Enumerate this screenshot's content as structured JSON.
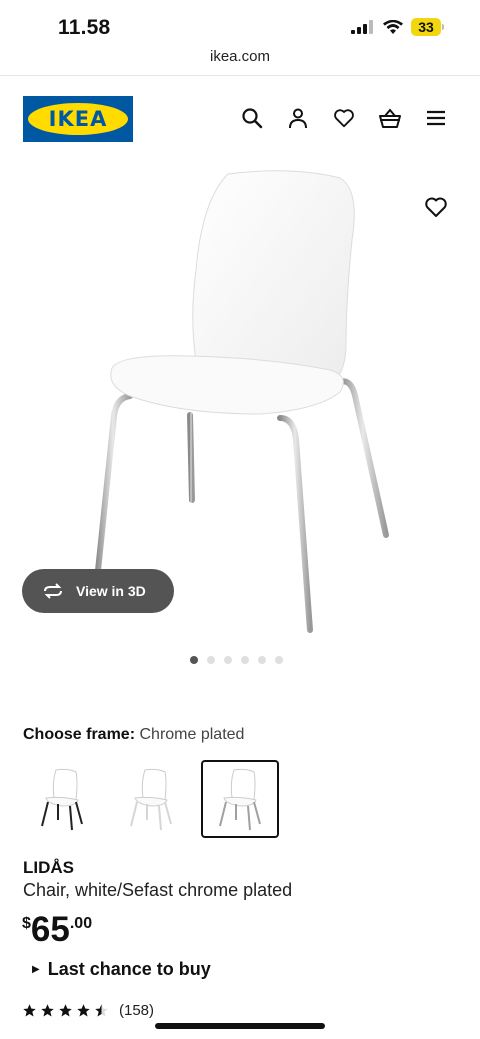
{
  "status_bar": {
    "time": "11.58",
    "battery": "33",
    "icons": [
      "signal-icon",
      "wifi-icon",
      "battery-icon"
    ]
  },
  "browser": {
    "url": "ikea.com"
  },
  "header": {
    "logo_text": "IKEA",
    "icons": [
      "search-icon",
      "account-icon",
      "favourites-icon",
      "basket-icon",
      "menu-icon"
    ],
    "colors": {
      "logo_blue": "#0058a3",
      "logo_yellow": "#ffdb00"
    }
  },
  "gallery": {
    "view_3d_label": "View in 3D",
    "image_count": 6,
    "active_index": 0
  },
  "frame": {
    "label": "Choose frame:",
    "selected": "Chrome plated",
    "options": [
      {
        "frame_color": "black"
      },
      {
        "frame_color": "white"
      },
      {
        "frame_color": "chrome"
      }
    ],
    "selected_index": 2
  },
  "product": {
    "name": "LIDÅS",
    "description": "Chair, white/Sefast chrome plated",
    "price": {
      "currency": "$",
      "integer": "65",
      "decimal": ".00"
    },
    "notice": "Last chance to buy",
    "rating": {
      "stars": 4.5,
      "count": "(158)"
    }
  }
}
